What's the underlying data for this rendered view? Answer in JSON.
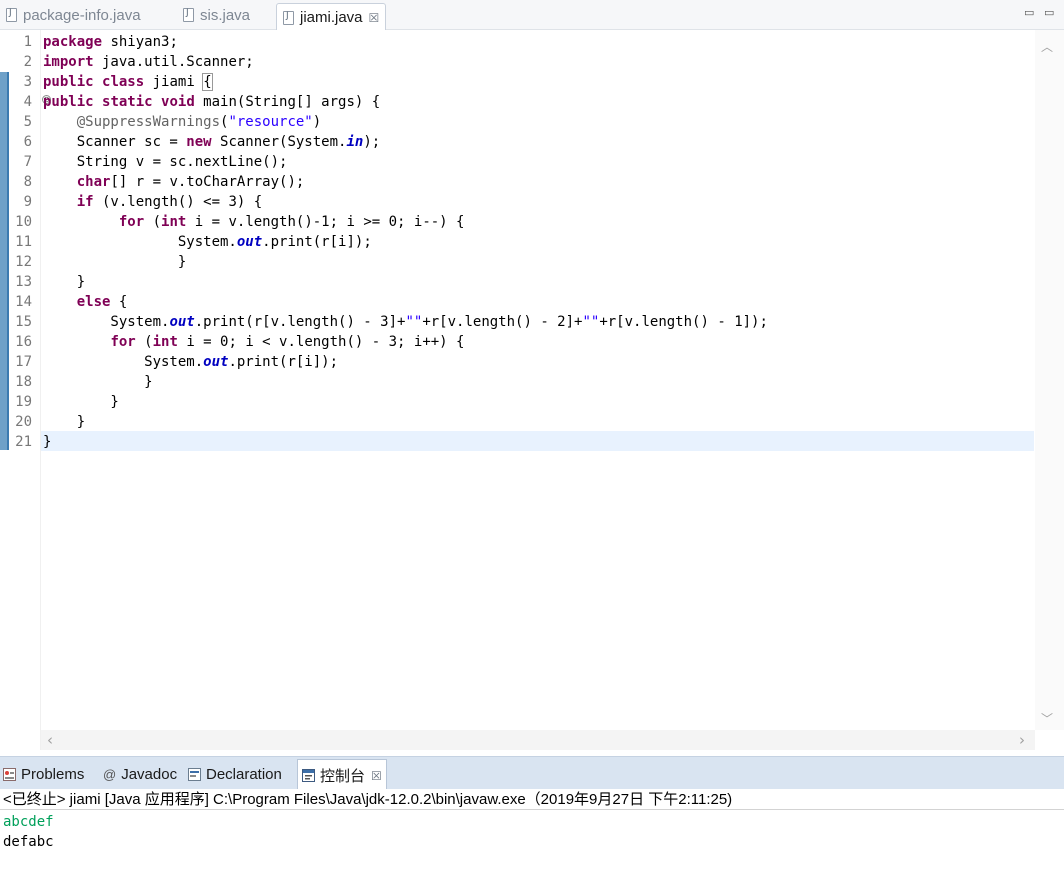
{
  "editor_tabs": [
    {
      "label": "package-info.java",
      "active": false
    },
    {
      "label": "sis.java",
      "active": false
    },
    {
      "label": "jiami.java",
      "active": true
    }
  ],
  "tab_close_glyph": "☒",
  "window_controls": {
    "minimize": "▭",
    "maximize": "▭"
  },
  "line_numbers": [
    "1",
    "2",
    "3",
    "4",
    "5",
    "6",
    "7",
    "8",
    "9",
    "10",
    "11",
    "12",
    "13",
    "14",
    "15",
    "16",
    "17",
    "18",
    "19",
    "20",
    "21"
  ],
  "code_lines": [
    [
      {
        "t": "package",
        "c": "kw"
      },
      {
        "t": " shiyan3;"
      }
    ],
    [
      {
        "t": "import",
        "c": "kw"
      },
      {
        "t": " java.util.Scanner;"
      }
    ],
    [
      {
        "t": "public",
        "c": "kw"
      },
      {
        "t": " "
      },
      {
        "t": "class",
        "c": "kw"
      },
      {
        "t": " jiami "
      },
      {
        "t": "{",
        "c": "brace-box"
      }
    ],
    [
      {
        "t": "public",
        "c": "kw"
      },
      {
        "t": " "
      },
      {
        "t": "static",
        "c": "kw"
      },
      {
        "t": " "
      },
      {
        "t": "void",
        "c": "kw"
      },
      {
        "t": " main(String[] args) {"
      }
    ],
    [
      {
        "t": "    "
      },
      {
        "t": "@SuppressWarnings",
        "c": "ann"
      },
      {
        "t": "("
      },
      {
        "t": "\"resource\"",
        "c": "str"
      },
      {
        "t": ")"
      }
    ],
    [
      {
        "t": "    Scanner sc = "
      },
      {
        "t": "new",
        "c": "kw"
      },
      {
        "t": " Scanner(System."
      },
      {
        "t": "in",
        "c": "fld"
      },
      {
        "t": ");"
      }
    ],
    [
      {
        "t": "    String v = sc.nextLine();"
      }
    ],
    [
      {
        "t": "    "
      },
      {
        "t": "char",
        "c": "kw"
      },
      {
        "t": "[] r = v.toCharArray();"
      }
    ],
    [
      {
        "t": "    "
      },
      {
        "t": "if",
        "c": "kw"
      },
      {
        "t": " (v.length() <= 3) {"
      }
    ],
    [
      {
        "t": "         "
      },
      {
        "t": "for",
        "c": "kw"
      },
      {
        "t": " ("
      },
      {
        "t": "int",
        "c": "kw"
      },
      {
        "t": " i = v.length()-1; i >= 0; i--) {"
      }
    ],
    [
      {
        "t": "                System."
      },
      {
        "t": "out",
        "c": "fld"
      },
      {
        "t": ".print(r[i]);"
      }
    ],
    [
      {
        "t": "                }"
      }
    ],
    [
      {
        "t": "    }"
      }
    ],
    [
      {
        "t": "    "
      },
      {
        "t": "else",
        "c": "kw"
      },
      {
        "t": " {"
      }
    ],
    [
      {
        "t": "        System."
      },
      {
        "t": "out",
        "c": "fld"
      },
      {
        "t": ".print(r[v.length() - 3]+"
      },
      {
        "t": "\"\"",
        "c": "str"
      },
      {
        "t": "+r[v.length() - 2]+"
      },
      {
        "t": "\"\"",
        "c": "str"
      },
      {
        "t": "+r[v.length() - 1]);"
      }
    ],
    [
      {
        "t": "        "
      },
      {
        "t": "for",
        "c": "kw"
      },
      {
        "t": " ("
      },
      {
        "t": "int",
        "c": "kw"
      },
      {
        "t": " i = 0; i < v.length() - 3; i++) {"
      }
    ],
    [
      {
        "t": "            System."
      },
      {
        "t": "out",
        "c": "fld"
      },
      {
        "t": ".print(r[i]);"
      }
    ],
    [
      {
        "t": "            }"
      }
    ],
    [
      {
        "t": "        }"
      }
    ],
    [
      {
        "t": "    }"
      }
    ],
    [
      {
        "t": "}"
      }
    ]
  ],
  "fold_marker": "⊖",
  "scroll_arrows": {
    "up": "︿",
    "down": "﹀",
    "left": "‹",
    "right": "›"
  },
  "panel_tabs": [
    {
      "label": "Problems",
      "icon": "problems-icon",
      "active": false
    },
    {
      "label": "Javadoc",
      "icon": "at-icon",
      "active": false
    },
    {
      "label": "Declaration",
      "icon": "declaration-icon",
      "active": false
    },
    {
      "label": "控制台",
      "icon": "console-icon",
      "active": true
    }
  ],
  "javadoc_glyph": "@",
  "console": {
    "header": "<已终止> jiami [Java 应用程序] C:\\Program Files\\Java\\jdk-12.0.2\\bin\\javaw.exe（2019年9月27日 下午2:11:25)",
    "input_line": "abcdef",
    "output_line": "defabc"
  },
  "colors": {
    "keyword": "#7f0055",
    "string": "#2a00ff",
    "annotation": "#646464",
    "static_field": "#0000c0",
    "console_input": "#00a05a",
    "current_line": "#e8f2fe"
  }
}
